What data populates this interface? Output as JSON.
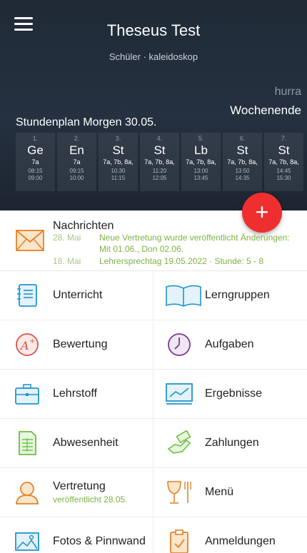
{
  "header": {
    "title": "Theseus Test",
    "subtitle": "Schüler · kaleidoskop",
    "greeting": "hurra",
    "status": "Wochenende",
    "schedule_title": "Stundenplan Morgen 30.05."
  },
  "periods": [
    {
      "num": "1.",
      "subject": "Ge",
      "classes": "7a",
      "start": "08:15",
      "end": "09:00"
    },
    {
      "num": "2.",
      "subject": "En",
      "classes": "7a",
      "start": "09:15",
      "end": "10:00"
    },
    {
      "num": "3.",
      "subject": "St",
      "classes": "7a, 7b, 8a,",
      "start": "10:30",
      "end": "11:15"
    },
    {
      "num": "4.",
      "subject": "St",
      "classes": "7a, 7b, 8a,",
      "start": "11:20",
      "end": "12:05"
    },
    {
      "num": "5.",
      "subject": "Lb",
      "classes": "7a, 7b, 8a,",
      "start": "13:00",
      "end": "13:45"
    },
    {
      "num": "6.",
      "subject": "St",
      "classes": "7a, 7b, 8a,",
      "start": "13:50",
      "end": "14:35"
    },
    {
      "num": "7.",
      "subject": "St",
      "classes": "7a, 7b, 8a,",
      "start": "14:45",
      "end": "15:30"
    }
  ],
  "fab": {
    "label": "+"
  },
  "news": {
    "title": "Nachrichten",
    "items": [
      {
        "date": "28. Mai",
        "text": "Neue Vertretung wurde veröffentlicht Änderungen:",
        "text2": "Mit 01.06., Don 02.06."
      },
      {
        "date": "18. Mai",
        "text": "Lehrersprechtag 19.05.2022 · Stunde: 5 - 8"
      }
    ]
  },
  "tiles": {
    "unterricht": {
      "label": "Unterricht"
    },
    "lerngruppen": {
      "label": "Lerngruppen"
    },
    "bewertung": {
      "label": "Bewertung"
    },
    "aufgaben": {
      "label": "Aufgaben"
    },
    "lehrstoff": {
      "label": "Lehrstoff"
    },
    "ergebnisse": {
      "label": "Ergebnisse"
    },
    "abwesenheit": {
      "label": "Abwesenheit"
    },
    "zahlungen": {
      "label": "Zahlungen"
    },
    "vertretung": {
      "label": "Vertretung",
      "sub": "veröffentlicht 28.05."
    },
    "menu": {
      "label": "Menü"
    },
    "fotos": {
      "label": "Fotos & Pinnwand"
    },
    "anmeldungen": {
      "label": "Anmeldungen"
    }
  },
  "colors": {
    "header_bg": "#1f2a36",
    "accent_red": "#ef2f2f",
    "accent_green": "#7cb342",
    "icon_blue": "#2196c9",
    "icon_orange": "#e3822a",
    "icon_green": "#6abf3d"
  }
}
